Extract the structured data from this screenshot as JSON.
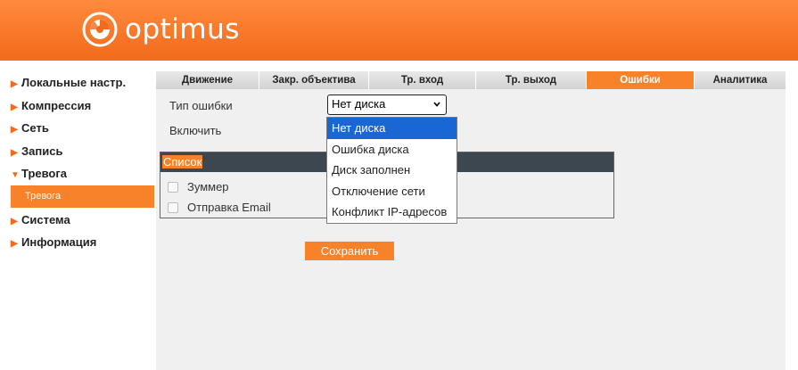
{
  "header": {
    "brand": "optimus"
  },
  "sidebar": {
    "items": [
      {
        "label": "Локальные настр.",
        "arrow": "▶"
      },
      {
        "label": "Компрессия",
        "arrow": "▶"
      },
      {
        "label": "Сеть",
        "arrow": "▶"
      },
      {
        "label": "Запись",
        "arrow": "▶"
      },
      {
        "label": "Тревога",
        "arrow": "▼"
      },
      {
        "label": "Система",
        "arrow": "▶"
      },
      {
        "label": "Информация",
        "arrow": "▶"
      }
    ],
    "subitem": {
      "label": "Тревога"
    }
  },
  "tabs": [
    "Движение",
    "Закр. объектива",
    "Тр. вход",
    "Тр. выход",
    "Ошибки",
    "Аналитика"
  ],
  "active_tab": "Ошибки",
  "form": {
    "error_type_label": "Тип ошибки",
    "error_type_value": "Нет диска",
    "enable_label": "Включить",
    "list_title": "Список",
    "buzzer_label": "Зуммер",
    "email_label": "Отправка Email",
    "save_label": "Сохранить"
  },
  "dropdown": {
    "options": [
      "Нет диска",
      "Ошибка диска",
      "Диск заполнен",
      "Отключение сети",
      "Конфликт IP-адресов"
    ],
    "selected_index": 0
  },
  "colors": {
    "accent": "#f7822a",
    "header": "#f26a1b",
    "list_header": "#3c4750",
    "selection": "#1967d2"
  }
}
